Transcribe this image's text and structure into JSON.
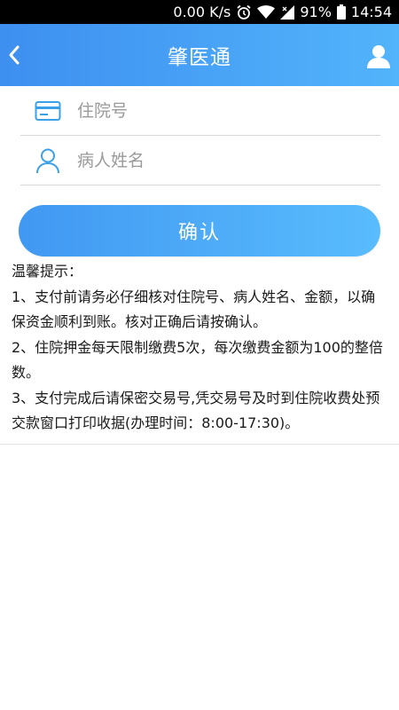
{
  "status_bar": {
    "speed": "0.00 K/s",
    "battery": "91%",
    "time": "14:54"
  },
  "header": {
    "title": "肇医通"
  },
  "form": {
    "hospital_no_placeholder": "住院号",
    "patient_name_placeholder": "病人姓名"
  },
  "confirm_button": {
    "label": "确认"
  },
  "tips": {
    "heading": "温馨提示：",
    "items": [
      "1、支付前请务必仔细核对住院号、病人姓名、金额，以确保资金顺利到账。核对正确后请按确认。",
      "2、住院押金每天限制缴费5次，每次缴费金额为100的整倍数。",
      "3、支付完成后请保密交易号,凭交易号及时到住院收费处预交款窗口打印收据(办理时间：8:00-17:30)。"
    ]
  },
  "colors": {
    "header_gradient_start": "#3e8ff0",
    "header_gradient_end": "#52b4fb",
    "icon_blue": "#3aa0e8"
  }
}
